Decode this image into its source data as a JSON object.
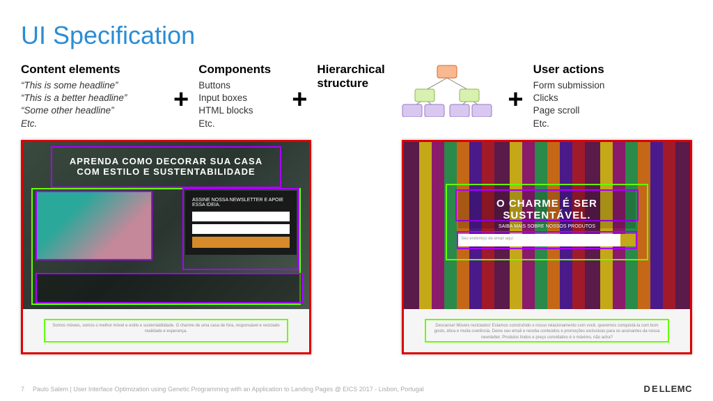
{
  "title": "UI Specification",
  "concepts": {
    "content": {
      "head": "Content elements",
      "items": [
        "“This is some headline”",
        "“This is a better headline”",
        "“Some other headline”",
        "Etc."
      ]
    },
    "components": {
      "head": "Components",
      "items": [
        "Buttons",
        "Input boxes",
        "HTML blocks",
        "Etc."
      ]
    },
    "hierarchy": {
      "head": "Hierarchical structure"
    },
    "actions": {
      "head": "User actions",
      "items": [
        "Form submission",
        "Clicks",
        "Page scroll",
        "Etc."
      ]
    }
  },
  "plus": "+",
  "example1": {
    "headline": "APRENDA COMO DECORAR SUA CASA COM ESTILO E SUSTENTABILIDADE",
    "form_label": "ASSINE NOSSA NEWSLETTER E APOIE ESSA IDEIA."
  },
  "example2": {
    "headline": "O CHARME É SER SUSTENTÁVEL.",
    "subhead": "SAIBA MAIS SOBRE NOSSOS PRODUTOS",
    "placeholder": "Seu endereço de email aqui"
  },
  "footer": {
    "slideno": "7",
    "credit": "Paulo Salem | User Interface Optimization using Genetic Programming with an Application to Landing Pages  @  EICS 2017 - Lisbon, Portugal",
    "logo": "D E LLEMC"
  }
}
